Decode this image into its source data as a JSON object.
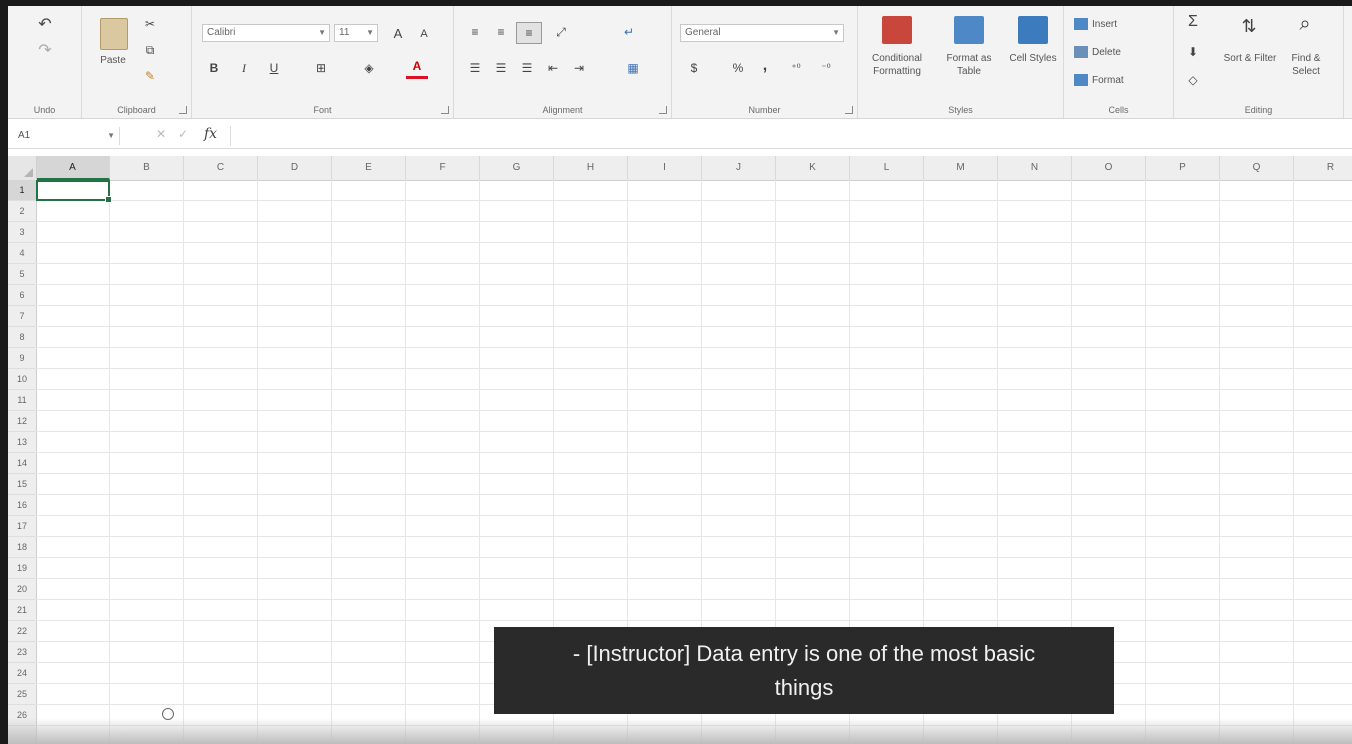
{
  "ribbon": {
    "undo": {
      "label": "Undo"
    },
    "clipboard": {
      "label": "Clipboard",
      "paste": "Paste"
    },
    "font": {
      "label": "Font",
      "name": "Calibri",
      "size": "11",
      "bold": "B",
      "italic": "I",
      "underline": "U",
      "grow": "A",
      "shrink": "A",
      "color_letter": "A"
    },
    "alignment": {
      "label": "Alignment"
    },
    "number": {
      "label": "Number",
      "format": "General",
      "currency": "$",
      "percent": "%",
      "comma": ","
    },
    "styles": {
      "label": "Styles",
      "conditional": "Conditional Formatting",
      "format_table": "Format as Table",
      "cell_styles": "Cell Styles"
    },
    "cells": {
      "label": "Cells",
      "insert": "Insert",
      "delete": "Delete",
      "format": "Format"
    },
    "editing": {
      "label": "Editing",
      "sort": "Sort & Filter",
      "find": "Find & Select",
      "sum": "Σ"
    }
  },
  "formula_bar": {
    "name_box": "A1",
    "fx": "fx",
    "value": ""
  },
  "columns": [
    "A",
    "B",
    "C",
    "D",
    "E",
    "F",
    "G",
    "H",
    "I",
    "J",
    "K",
    "L",
    "M",
    "N",
    "O",
    "P",
    "Q",
    "R"
  ],
  "rows": [
    "1",
    "2",
    "3",
    "4",
    "5",
    "6",
    "7",
    "8",
    "9",
    "10",
    "11",
    "12",
    "13",
    "14",
    "15",
    "16",
    "17",
    "18",
    "19",
    "20",
    "21",
    "22",
    "23",
    "24",
    "25",
    "26"
  ],
  "active_cell": "A1",
  "caption": {
    "line1": "- [Instructor] Data entry is one of the most basic",
    "line2": "things"
  },
  "colors": {
    "accent": "#217346",
    "caption_bg": "#2a2a2a"
  }
}
